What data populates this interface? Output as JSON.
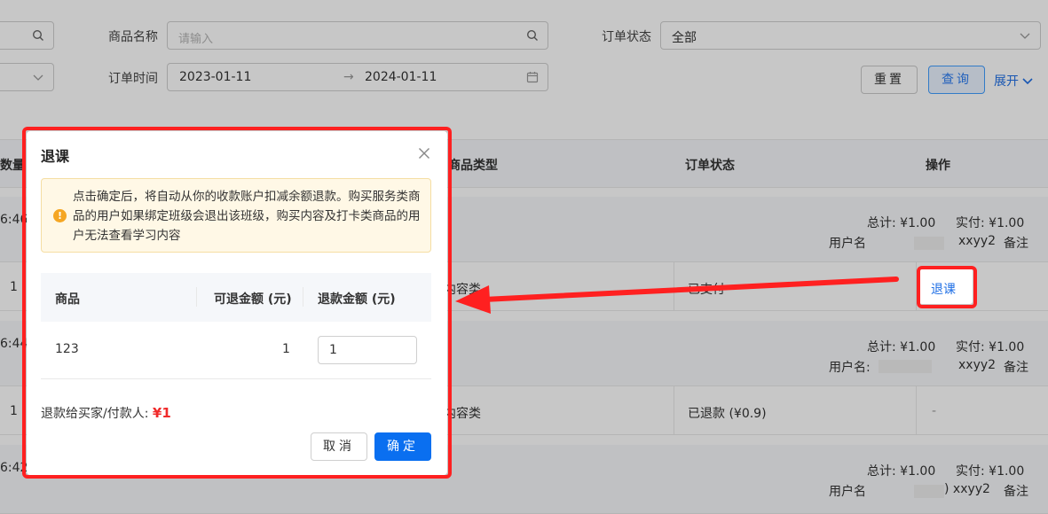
{
  "filters": {
    "product_name_label": "商品名称",
    "product_name_placeholder": "请输入",
    "order_status_label": "订单状态",
    "order_status_value": "全部",
    "order_time_label": "订单时间",
    "date_start": "2023-01-11",
    "date_arrow": "→",
    "date_end": "2024-01-11",
    "reset_label": "重置",
    "query_label": "查询",
    "expand_label": "展开"
  },
  "table": {
    "headers": {
      "quantity": "数量",
      "product_type": "商品类型",
      "order_status": "订单状态",
      "action": "操作"
    },
    "groups": [
      {
        "time_fragment": "6:46",
        "total_label": "总计: ¥1.00",
        "paid_label": "实付: ¥1.00",
        "username_label": "用户名",
        "user_tail": "xxyy2",
        "note_link": "备注",
        "qty": "1",
        "product_type": "内容类",
        "status": "已支付",
        "action": "退课"
      },
      {
        "time_fragment": "6:44",
        "total_label": "总计: ¥1.00",
        "paid_label": "实付: ¥1.00",
        "username_label": "用户名:",
        "user_tail": "xxyy2",
        "note_link": "备注",
        "qty": "1",
        "product_type": "内容类",
        "status": "已退款 (¥0.9)",
        "action": "-"
      },
      {
        "time_fragment": "6:42",
        "total_label": "总计: ¥1.00",
        "paid_label": "实付: ¥1.00",
        "username_label": "用户名",
        "user_tail": ") xxyy2",
        "note_link": "备注"
      }
    ]
  },
  "modal": {
    "title": "退课",
    "close_icon": "close-icon",
    "notice_text": "点击确定后，将自动从你的收款账户扣减余额退款。购买服务类商品的用户如果绑定班级会退出该班级，购买内容及打卡类商品的用户无法查看学习内容",
    "columns": [
      "商品",
      "可退金额 (元)",
      "退款金额 (元)"
    ],
    "row": {
      "product": "123",
      "refundable": "1",
      "refund_amount": "1"
    },
    "refund_to_label": "退款给买家/付款人:",
    "refund_total": "¥1",
    "cancel_label": "取消",
    "confirm_label": "确定"
  },
  "colors": {
    "highlight_red": "#ff2020",
    "primary": "#0a6ff0",
    "link": "#1f6fe5",
    "price_red": "#f02b2b"
  }
}
